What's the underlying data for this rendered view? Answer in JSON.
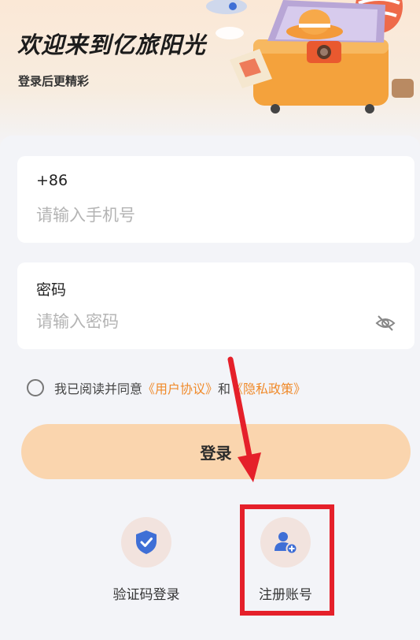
{
  "header": {
    "title": "欢迎来到亿旅阳光",
    "subtitle": "登录后更精彩"
  },
  "phone": {
    "label": "+86",
    "placeholder": "请输入手机号",
    "value": ""
  },
  "password": {
    "label": "密码",
    "placeholder": "请输入密码",
    "value": "",
    "visibility_icon": "eye-off-icon"
  },
  "agreement": {
    "prefix": "我已阅读并同意",
    "user_agreement": "《用户协议》",
    "conjunction": "和",
    "privacy_policy": "《隐私政策》",
    "checked": false
  },
  "login_button": "登录",
  "alt_options": [
    {
      "label": "验证码登录",
      "icon": "shield-check-icon"
    },
    {
      "label": "注册账号",
      "icon": "add-user-icon"
    }
  ],
  "colors": {
    "accent": "#f08a2a",
    "login_button_bg": "#fad5ae",
    "icon_blue": "#3f6fd6",
    "annotation_red": "#e5202a"
  }
}
